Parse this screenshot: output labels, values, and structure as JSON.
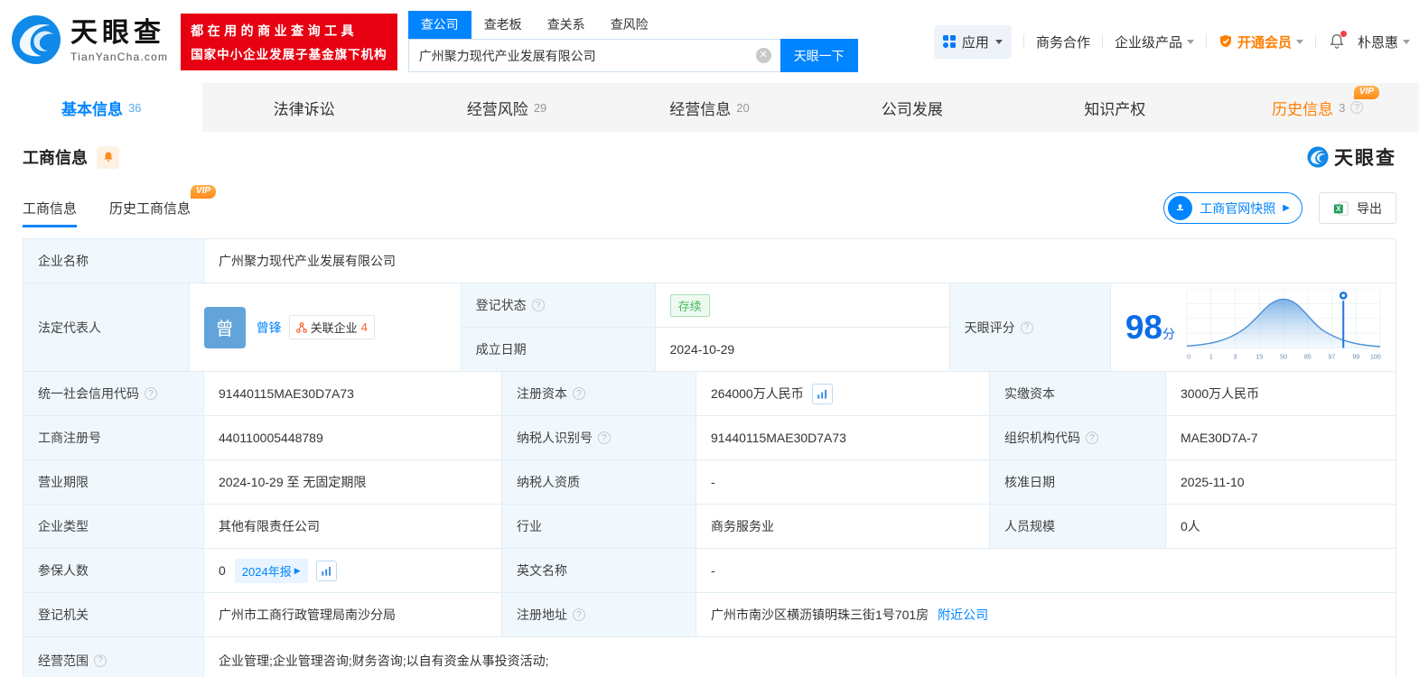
{
  "header": {
    "logo": {
      "brand": "天眼查",
      "domain": "TianYanCha.com"
    },
    "banner": {
      "line1": "都在用的商业查询工具",
      "line2": "国家中小企业发展子基金旗下机构"
    },
    "search": {
      "tabs": [
        {
          "label": "查公司"
        },
        {
          "label": "查老板"
        },
        {
          "label": "查关系"
        },
        {
          "label": "查风险"
        }
      ],
      "value": "广州聚力现代产业发展有限公司",
      "button": "天眼一下"
    },
    "nav": {
      "apps": "应用",
      "cooperation": "商务合作",
      "enterprise": "企业级产品",
      "membership": "开通会员",
      "user": "朴恩惠"
    }
  },
  "main_tabs": [
    {
      "label": "基本信息",
      "count": "36"
    },
    {
      "label": "法律诉讼",
      "count": ""
    },
    {
      "label": "经营风险",
      "count": "29"
    },
    {
      "label": "经营信息",
      "count": "20"
    },
    {
      "label": "公司发展",
      "count": ""
    },
    {
      "label": "知识产权",
      "count": ""
    },
    {
      "label": "历史信息",
      "count": "3"
    }
  ],
  "vip_label": "VIP",
  "section": {
    "title": "工商信息",
    "watermark": "天眼查",
    "subtabs": [
      {
        "label": "工商信息"
      },
      {
        "label": "历史工商信息"
      }
    ],
    "snapshot_button": "工商官网快照",
    "export_button": "导出"
  },
  "info": {
    "company_name": {
      "label": "企业名称",
      "value": "广州聚力现代产业发展有限公司"
    },
    "legal_rep": {
      "label": "法定代表人",
      "avatar": "曾",
      "name": "曾锋",
      "related_label": "关联企业",
      "related_count": "4"
    },
    "reg_status": {
      "label": "登记状态",
      "value": "存续"
    },
    "establish_date": {
      "label": "成立日期",
      "value": "2024-10-29"
    },
    "score": {
      "label": "天眼评分",
      "value": "98",
      "unit": "分",
      "ticks": [
        "0",
        "1",
        "3",
        "15",
        "50",
        "85",
        "97",
        "99",
        "100"
      ]
    },
    "credit_code": {
      "label": "统一社会信用代码",
      "value": "91440115MAE30D7A73"
    },
    "reg_capital": {
      "label": "注册资本",
      "value": "264000万人民币"
    },
    "paid_capital": {
      "label": "实缴资本",
      "value": "3000万人民币"
    },
    "reg_number": {
      "label": "工商注册号",
      "value": "440110005448789"
    },
    "taxpayer_id": {
      "label": "纳税人识别号",
      "value": "91440115MAE30D7A73"
    },
    "org_code": {
      "label": "组织机构代码",
      "value": "MAE30D7A-7"
    },
    "business_term": {
      "label": "营业期限",
      "value": "2024-10-29 至 无固定期限"
    },
    "taxpayer_qualification": {
      "label": "纳税人资质",
      "value": "-"
    },
    "approval_date": {
      "label": "核准日期",
      "value": "2025-11-10"
    },
    "company_type": {
      "label": "企业类型",
      "value": "其他有限责任公司"
    },
    "industry": {
      "label": "行业",
      "value": "商务服务业"
    },
    "staff_size": {
      "label": "人员规模",
      "value": "0人"
    },
    "insured": {
      "label": "参保人数",
      "value": "0",
      "report_badge": "2024年报"
    },
    "english_name": {
      "label": "英文名称",
      "value": "-"
    },
    "reg_authority": {
      "label": "登记机关",
      "value": "广州市工商行政管理局南沙分局"
    },
    "reg_address": {
      "label": "注册地址",
      "value": "广州市南沙区横沥镇明珠三街1号701房",
      "nearby_link": "附近公司"
    },
    "business_scope": {
      "label": "经营范围",
      "value": "企业管理;企业管理咨询;财务咨询;以自有资金从事投资活动;"
    }
  },
  "colors": {
    "brand_blue": "#0084ff",
    "banner_red": "#e60012",
    "vip_orange": "#ff8c1a",
    "status_green": "#43b95e"
  }
}
